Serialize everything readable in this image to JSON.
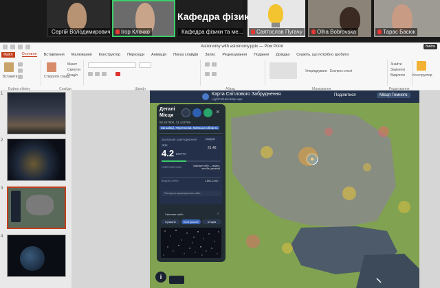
{
  "zoom": {
    "participants": [
      {
        "name": "Сергій Володимирович"
      },
      {
        "name": "Ігор Клочко"
      },
      {
        "name": "Кафедра фізики та ме..."
      },
      {
        "name": "Святослав Пугачу"
      },
      {
        "name": "Olha Bobrovska"
      },
      {
        "name": "Тарас Басюк"
      }
    ],
    "kafedra_title": "Кафедра фізик..."
  },
  "ppt": {
    "doc_title": "Astronomy with astronomy.pptx — Pow Point",
    "account": "Вийти",
    "tabs": [
      "Файл",
      "Основне",
      "Вставлення",
      "Малювання",
      "Конструктор",
      "Переходи",
      "Анімація",
      "Показ слайдів",
      "Запис",
      "Рецензування",
      "Подання",
      "Довідка"
    ],
    "tell_me": "Скажіть, що потрібно зробити",
    "ribbon_groups": [
      "Буфер обміну",
      "Слайди",
      "Шрифт",
      "Абзац",
      "Малювання",
      "Редагування"
    ],
    "ribbon_labels": {
      "paste": "Вставити",
      "new_slide": "Створити слайд",
      "layout": "Макет",
      "reset": "Скинути",
      "section": "Розділ",
      "arrange": "Упорядкувати",
      "quick_styles": "Експрес-стилі",
      "find": "Знайти",
      "replace": "Замінити",
      "select": "Виділити",
      "designer": "Конструктор"
    },
    "slide_numbers": [
      "1",
      "2",
      "3",
      "4"
    ]
  },
  "map": {
    "title": "Карта Світлового Забруднення",
    "url": "LightPollutionMap.app",
    "share": "Поділитися",
    "dark_sites": "Місця Темного",
    "panel": {
      "heading_line1": "Деталі",
      "heading_line2": "Місця",
      "coords": "50.467800, 31.443789",
      "location": "Заньківці, Переяслав, Київська область",
      "section_label": "ЗАГАЛЬНЕ ЗАБРУДНЕННЯ",
      "source_tag": "Помірне",
      "small_tag": "ЗНЕ",
      "value": "4.2",
      "unit": "БОРТЛ",
      "sqm": "21.46",
      "row1_label": "НЕБЕСНИЙ КЛАС",
      "row1_value": "Заміське небо — видно, але без деталей",
      "row2_label": "ВИДИМІ ЗІРКИ",
      "row2_value": "1,800–2,500",
      "expand_text": "Поглад на характеристики неба...",
      "sky_section": "Світлове небо",
      "toggle_on": "Сучасне",
      "toggle_mid": "Контрольне",
      "toggle_off": "Історія"
    },
    "info": "i"
  },
  "colors": {
    "accent_red": "#c43e1c",
    "zoom_active": "#3ad16b",
    "panel_bg": "#1c2432",
    "share_blue": "#4a90e2"
  }
}
